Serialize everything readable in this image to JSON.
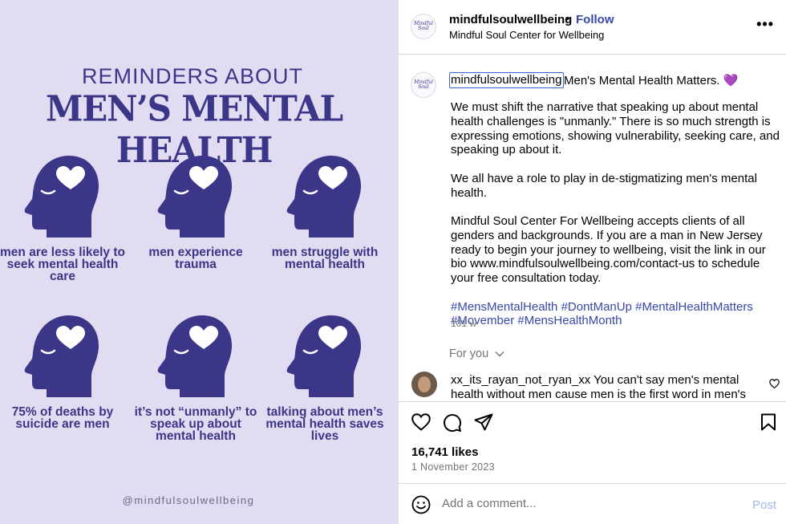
{
  "image": {
    "heading_line1": "REMINDERS ABOUT",
    "heading_line2": "MEN’S MENTAL HEALTH",
    "items": [
      {
        "caption": "men are less likely to seek mental health care"
      },
      {
        "caption": "men experience trauma"
      },
      {
        "caption": "men struggle with mental health"
      },
      {
        "caption": "75% of deaths by suicide are men"
      },
      {
        "caption": "it’s not “unmanly” to speak up about mental health"
      },
      {
        "caption": "talking about men’s mental health saves lives"
      }
    ],
    "handle": "@mindfulsoulwellbeing",
    "colors": {
      "background": "#e1dcf2",
      "accent": "#3c3688"
    }
  },
  "header": {
    "avatar_text": "Mindful Soul",
    "username": "mindfulsoulwellbeing",
    "separator": "•",
    "follow_label": "Follow",
    "subtitle": "Mindful Soul Center for Wellbeing",
    "more_label": "•••"
  },
  "caption": {
    "username": "mindfulsoulwellbeing",
    "headline": "Men's Mental Health Matters. 💜",
    "paragraph1": "We must shift the narrative that speaking up about mental health challenges is \"unmanly.\" There is so much strength is expressing emotions, showing vulnerability, seeking care, and speaking up about it.",
    "paragraph2": "We all have a role to play in de-stigmatizing men's mental health.",
    "paragraph3": "Mindful Soul Center For Wellbeing accepts clients of all genders and backgrounds. If you are a man in New Jersey ready to begin your journey to wellbeing, visit the link in our bio www.mindfulsoulwellbeing.com/contact-us to schedule your free consultation today.",
    "hashtags": "#MensMentalHealth #DontManUp #MentalHealthMatters #Movember #MensHealthMonth",
    "time_ago": "101 w"
  },
  "comments": {
    "sort_label": "For you",
    "sort_icon": "chevron-down-icon",
    "items": [
      {
        "username": "xx_its_rayan_not_ryan_xx",
        "text": "You can't say men's mental health without men cause men is the first word in men's"
      }
    ]
  },
  "actions": {
    "likes": "16,741 likes",
    "date": "1 November 2023",
    "icons": [
      "heart-icon",
      "comment-icon",
      "share-icon",
      "bookmark-icon"
    ]
  },
  "add_comment": {
    "placeholder": "Add a comment...",
    "post_label": "Post",
    "emoji_icon": "emoji-icon"
  },
  "colors": {
    "link": "#3848a8",
    "muted": "#737373",
    "border": "#dbdbdb",
    "post_disabled": "#a4b8e8"
  }
}
